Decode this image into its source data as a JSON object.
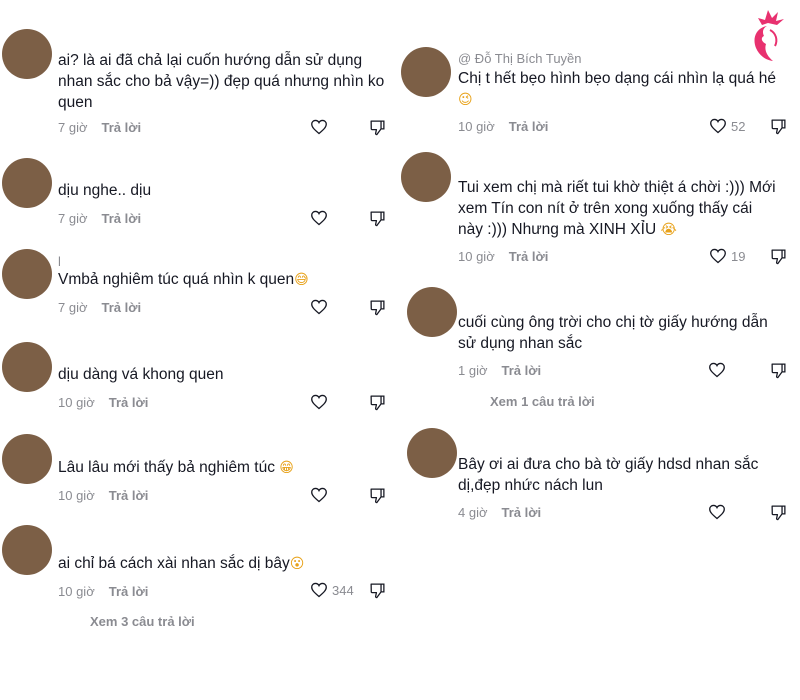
{
  "left_comments": [
    {
      "handle": "",
      "text": "ai? là ai đã chả lại cuốn hướng dẫn sử dụng nhan sắc cho bả vậy=)) đẹp quá nhưng nhìn ko quen",
      "emoji": "",
      "time": "7 giờ",
      "reply": "Trả lời",
      "likes": ""
    },
    {
      "handle": "",
      "text": "dịu nghe.. dịu",
      "emoji": "",
      "time": "7 giờ",
      "reply": "Trả lời",
      "likes": ""
    },
    {
      "handle": "l",
      "text": "Vmbả nghiêm túc quá nhìn k quen",
      "emoji": "😅",
      "time": "7 giờ",
      "reply": "Trả lời",
      "likes": ""
    },
    {
      "handle": "",
      "text": "dịu dàng vá khong quen",
      "emoji": "",
      "time": "10 giờ",
      "reply": "Trả lời",
      "likes": ""
    },
    {
      "handle": "",
      "text": "Lâu lâu mới thấy bả nghiêm túc",
      "emoji": "😁",
      "time": "10 giờ",
      "reply": "Trả lời",
      "likes": ""
    },
    {
      "handle": "",
      "text": "ai chỉ bá cách xài nhan sắc dị bây",
      "emoji": "😮",
      "time": "10 giờ",
      "reply": "Trả lời",
      "likes": "344"
    }
  ],
  "left_more": "Xem 3 câu trả lời",
  "right_comments": [
    {
      "handle": "@ Đỗ Thị Bích Tuyền",
      "text": "Chị t hết bẹo hình bẹo dạng cái nhìn lạ quá hé",
      "emoji": "😉",
      "time": "10 giờ",
      "reply": "Trả lời",
      "likes": "52"
    },
    {
      "handle": "",
      "text": "Tui xem chị mà riết tui khờ thiệt á chời :))) Mới xem Tín con nít ở trên xong xuống thấy cái này :))) Nhưng mà XINH XỈU",
      "emoji": "😭",
      "time": "10 giờ",
      "reply": "Trả lời",
      "likes": "19"
    },
    {
      "handle": "",
      "text": "cuối cùng ông trời cho chị tờ giấy hướng dẫn sử dụng nhan sắc",
      "emoji": "",
      "time": "1 giờ",
      "reply": "Trả lời",
      "likes": ""
    },
    {
      "handle": "",
      "text": "Bây ơi ai đưa cho bà tờ giấy hdsd nhan sắc dị,đẹp nhức nách lun",
      "emoji": "",
      "time": "4 giờ",
      "reply": "Trả lời",
      "likes": ""
    }
  ],
  "right_more": "Xem 1 câu trả lời",
  "icons": {
    "like": "heart-outline-icon",
    "dislike": "thumbs-down-icon",
    "logo": "woman-profile-flower-logo"
  },
  "colors": {
    "avatar": "#7c5f46",
    "muted": "#8a8b91",
    "text": "#161823",
    "logo": "#e8316f"
  }
}
